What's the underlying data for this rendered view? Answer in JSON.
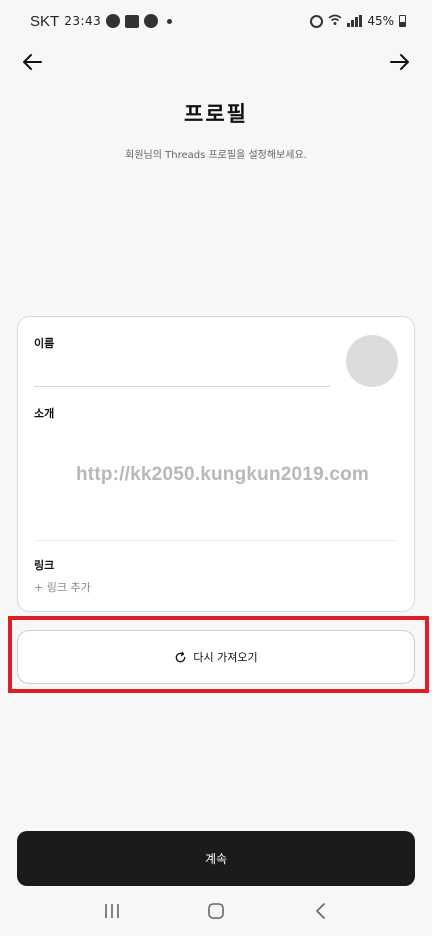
{
  "status_bar": {
    "carrier": "SKT",
    "time": "23:43",
    "battery": "45%"
  },
  "header": {
    "title": "프로필",
    "subtitle": "회원님의 Threads 프로필을 설정해보세요."
  },
  "profile_form": {
    "name_label": "이름",
    "name_value": "",
    "bio_label": "소개",
    "bio_value": "",
    "link_label": "링크",
    "add_link": "+ 링크 추가"
  },
  "watermark": "http://kk2050.kungkun2019.com",
  "reimport_button": "다시 가져오기",
  "continue_button": "계속",
  "colors": {
    "highlight": "#e01e26",
    "primary_button": "#1b1b1b",
    "background": "#f7f7f7"
  },
  "icons": {
    "back": "arrow-left-icon",
    "forward": "arrow-right-icon",
    "refresh": "refresh-icon",
    "recents": "recents-icon",
    "home": "home-icon",
    "system_back": "chevron-left-icon"
  }
}
